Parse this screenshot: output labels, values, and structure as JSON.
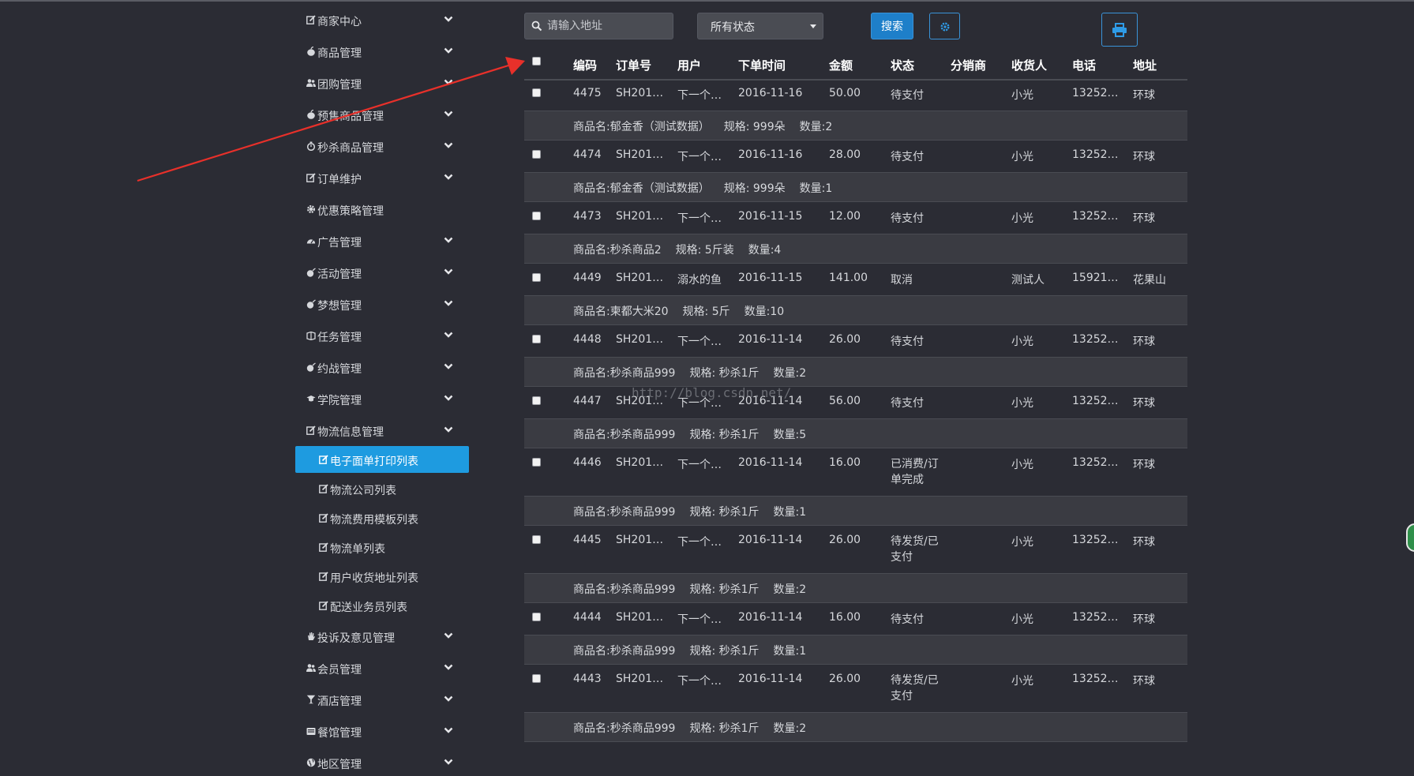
{
  "sidebar": {
    "items": [
      {
        "label": "商家中心",
        "icon": "edit-icon",
        "chevron": true
      },
      {
        "label": "商品管理",
        "icon": "apple-icon",
        "chevron": true
      },
      {
        "label": "团购管理",
        "icon": "users-icon",
        "chevron": true
      },
      {
        "label": "预售商品管理",
        "icon": "apple-icon",
        "chevron": true
      },
      {
        "label": "秒杀商品管理",
        "icon": "stopwatch-icon",
        "chevron": true
      },
      {
        "label": "订单维护",
        "icon": "edit-icon",
        "chevron": true
      },
      {
        "label": "优惠策略管理",
        "icon": "gear-icon",
        "chevron": false
      },
      {
        "label": "广告管理",
        "icon": "dashboard-icon",
        "chevron": true
      },
      {
        "label": "活动管理",
        "icon": "bomb-icon",
        "chevron": true
      },
      {
        "label": "梦想管理",
        "icon": "bomb-icon",
        "chevron": true
      },
      {
        "label": "任务管理",
        "icon": "book-icon",
        "chevron": true
      },
      {
        "label": "约战管理",
        "icon": "bomb-icon",
        "chevron": true
      },
      {
        "label": "学院管理",
        "icon": "graduation-cap-icon",
        "chevron": true
      },
      {
        "label": "物流信息管理",
        "icon": "edit-icon",
        "chevron": true
      }
    ],
    "sub_items": [
      {
        "label": "电子面单打印列表",
        "active": true
      },
      {
        "label": "物流公司列表",
        "active": false
      },
      {
        "label": "物流费用模板列表",
        "active": false
      },
      {
        "label": "物流单列表",
        "active": false
      },
      {
        "label": "用户收货地址列表",
        "active": false
      },
      {
        "label": "配送业务员列表",
        "active": false
      }
    ],
    "items_after": [
      {
        "label": "投诉及意见管理",
        "icon": "hand-icon",
        "chevron": true
      },
      {
        "label": "会员管理",
        "icon": "users-icon",
        "chevron": true
      },
      {
        "label": "酒店管理",
        "icon": "glass-icon",
        "chevron": true
      },
      {
        "label": "餐馆管理",
        "icon": "restaurant-icon",
        "chevron": true
      },
      {
        "label": "地区管理",
        "icon": "globe-icon",
        "chevron": true
      }
    ]
  },
  "toolbar": {
    "search_placeholder": "请输入地址",
    "status_selected": "所有状态",
    "search_label": "搜索",
    "settings_icon": "gear-icon",
    "print_icon": "print-icon"
  },
  "table": {
    "headers": [
      "编码",
      "订单号",
      "用户",
      "下单时间",
      "金额",
      "状态",
      "分销商",
      "收货人",
      "电话",
      "地址"
    ],
    "orders": [
      {
        "id": "4475",
        "order_no": "SH201…",
        "user": "下一个…",
        "time": "2016-11-16",
        "amount": "50.00",
        "status": "待支付",
        "distributor": "",
        "receiver": "小光",
        "phone": "13252…",
        "address": "环球",
        "detail": {
          "product": "商品名:郁金香（测试数据）",
          "spec": "规格: 999朵",
          "qty": "数量:2"
        }
      },
      {
        "id": "4474",
        "order_no": "SH201…",
        "user": "下一个…",
        "time": "2016-11-16",
        "amount": "28.00",
        "status": "待支付",
        "distributor": "",
        "receiver": "小光",
        "phone": "13252…",
        "address": "环球",
        "detail": {
          "product": "商品名:郁金香（测试数据）",
          "spec": "规格: 999朵",
          "qty": "数量:1"
        }
      },
      {
        "id": "4473",
        "order_no": "SH201…",
        "user": "下一个…",
        "time": "2016-11-15",
        "amount": "12.00",
        "status": "待支付",
        "distributor": "",
        "receiver": "小光",
        "phone": "13252…",
        "address": "环球",
        "detail": {
          "product": "商品名:秒杀商品2",
          "spec": "规格: 5斤装",
          "qty": "数量:4"
        }
      },
      {
        "id": "4449",
        "order_no": "SH201…",
        "user": "溺水的鱼",
        "time": "2016-11-15",
        "amount": "141.00",
        "status": "取消",
        "distributor": "",
        "receiver": "测试人",
        "phone": "15921…",
        "address": "花果山",
        "detail": {
          "product": "商品名:柬都大米20",
          "spec": "规格: 5斤",
          "qty": "数量:10"
        }
      },
      {
        "id": "4448",
        "order_no": "SH201…",
        "user": "下一个…",
        "time": "2016-11-14",
        "amount": "26.00",
        "status": "待支付",
        "distributor": "",
        "receiver": "小光",
        "phone": "13252…",
        "address": "环球",
        "detail": {
          "product": "商品名:秒杀商品999",
          "spec": "规格: 秒杀1斤",
          "qty": "数量:2"
        }
      },
      {
        "id": "4447",
        "order_no": "SH201…",
        "user": "下一个…",
        "time": "2016-11-14",
        "amount": "56.00",
        "status": "待支付",
        "distributor": "",
        "receiver": "小光",
        "phone": "13252…",
        "address": "环球",
        "detail": {
          "product": "商品名:秒杀商品999",
          "spec": "规格: 秒杀1斤",
          "qty": "数量:5"
        }
      },
      {
        "id": "4446",
        "order_no": "SH201…",
        "user": "下一个…",
        "time": "2016-11-14",
        "amount": "16.00",
        "status": "已消费/订单完成",
        "distributor": "",
        "receiver": "小光",
        "phone": "13252…",
        "address": "环球",
        "detail": {
          "product": "商品名:秒杀商品999",
          "spec": "规格: 秒杀1斤",
          "qty": "数量:1"
        }
      },
      {
        "id": "4445",
        "order_no": "SH201…",
        "user": "下一个…",
        "time": "2016-11-14",
        "amount": "26.00",
        "status": "待发货/已支付",
        "distributor": "",
        "receiver": "小光",
        "phone": "13252…",
        "address": "环球",
        "detail": {
          "product": "商品名:秒杀商品999",
          "spec": "规格: 秒杀1斤",
          "qty": "数量:2"
        }
      },
      {
        "id": "4444",
        "order_no": "SH201…",
        "user": "下一个…",
        "time": "2016-11-14",
        "amount": "16.00",
        "status": "待支付",
        "distributor": "",
        "receiver": "小光",
        "phone": "13252…",
        "address": "环球",
        "detail": {
          "product": "商品名:秒杀商品999",
          "spec": "规格: 秒杀1斤",
          "qty": "数量:1"
        }
      },
      {
        "id": "4443",
        "order_no": "SH201…",
        "user": "下一个…",
        "time": "2016-11-14",
        "amount": "26.00",
        "status": "待发货/已支付",
        "distributor": "",
        "receiver": "小光",
        "phone": "13252…",
        "address": "环球",
        "detail": {
          "product": "商品名:秒杀商品999",
          "spec": "规格: 秒杀1斤",
          "qty": "数量:2"
        }
      }
    ]
  },
  "watermark": "http://blog.csdn.net/",
  "colors": {
    "accent": "#1e9be0",
    "button": "#1e7fc9",
    "background": "#2b2c34",
    "arrow": "#e8302a"
  }
}
